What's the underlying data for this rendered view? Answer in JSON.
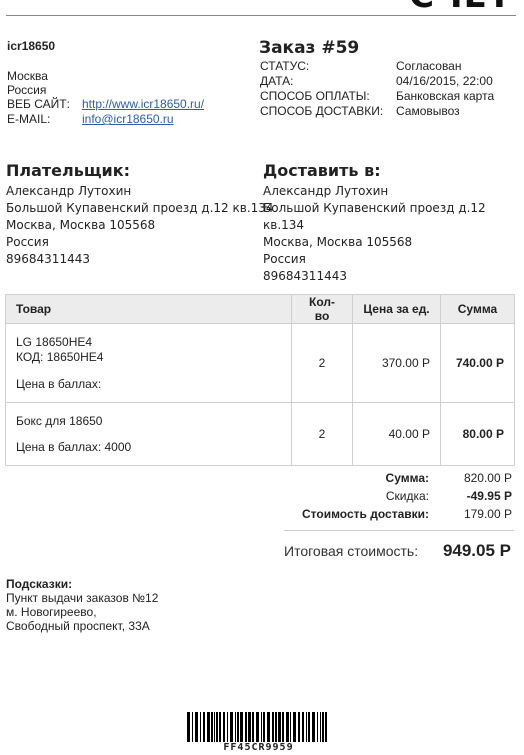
{
  "document": {
    "heading": "СЧЕТ"
  },
  "shop": {
    "name": "icr18650",
    "city": "Москва",
    "country": "Россия",
    "website_label": "ВЕБ САЙТ:",
    "website": "http://www.icr18650.ru/",
    "email_label": "E-MAIL:",
    "email": "info@icr18650.ru"
  },
  "order": {
    "title": "Заказ #59",
    "status_label": "СТАТУС:",
    "status": "Согласован",
    "date_label": "ДАТА:",
    "date": "04/16/2015, 22:00",
    "payment_label": "СПОСОБ ОПЛАТЫ:",
    "payment": "Банковская карта",
    "delivery_label": "СПОСОБ ДОСТАВКИ:",
    "delivery": "Самовывоз"
  },
  "payer": {
    "title": "Плательщик:",
    "name": "Александр Лутохин",
    "street": "Большой Купавенский проезд д.12 кв.134",
    "city": "Москва, Москва 105568",
    "country": "Россия",
    "phone": "89684311443"
  },
  "ship_to": {
    "title": "Доставить в:",
    "name": "Александр Лутохин",
    "street": "Большой Купавенский проезд д.12 кв.134",
    "city": "Москва, Москва 105568",
    "country": "Россия",
    "phone": "89684311443"
  },
  "table": {
    "headers": {
      "product": "Товар",
      "qty": "Кол-во",
      "price": "Цена за ед.",
      "sum": "Сумма"
    },
    "rows": [
      {
        "name": "LG 18650HE4",
        "code": "КОД: 18650HE4",
        "points": "Цена в баллах:",
        "qty": "2",
        "price": "370.00 Р",
        "sum": "740.00 Р"
      },
      {
        "name": "Бокс для 18650",
        "points": "Цена в баллах: 4000",
        "qty": "2",
        "price": "40.00 Р",
        "sum": "80.00 Р"
      }
    ]
  },
  "totals": {
    "subtotal_label": "Сумма:",
    "subtotal": "820.00 Р",
    "discount_label": "Скидка:",
    "discount": "-49.95 Р",
    "shipping_label": "Стоимость доставки:",
    "shipping": "179.00 Р",
    "grand_label": "Итоговая стоимость:",
    "grand": "949.05 Р"
  },
  "hints": {
    "title": "Подсказки:",
    "line1": "Пункт выдачи заказов №12",
    "line2": "м. Новогиреево,",
    "line3": "Свободный проспект, 33А"
  },
  "barcode": {
    "code": "FF45CR9959"
  }
}
